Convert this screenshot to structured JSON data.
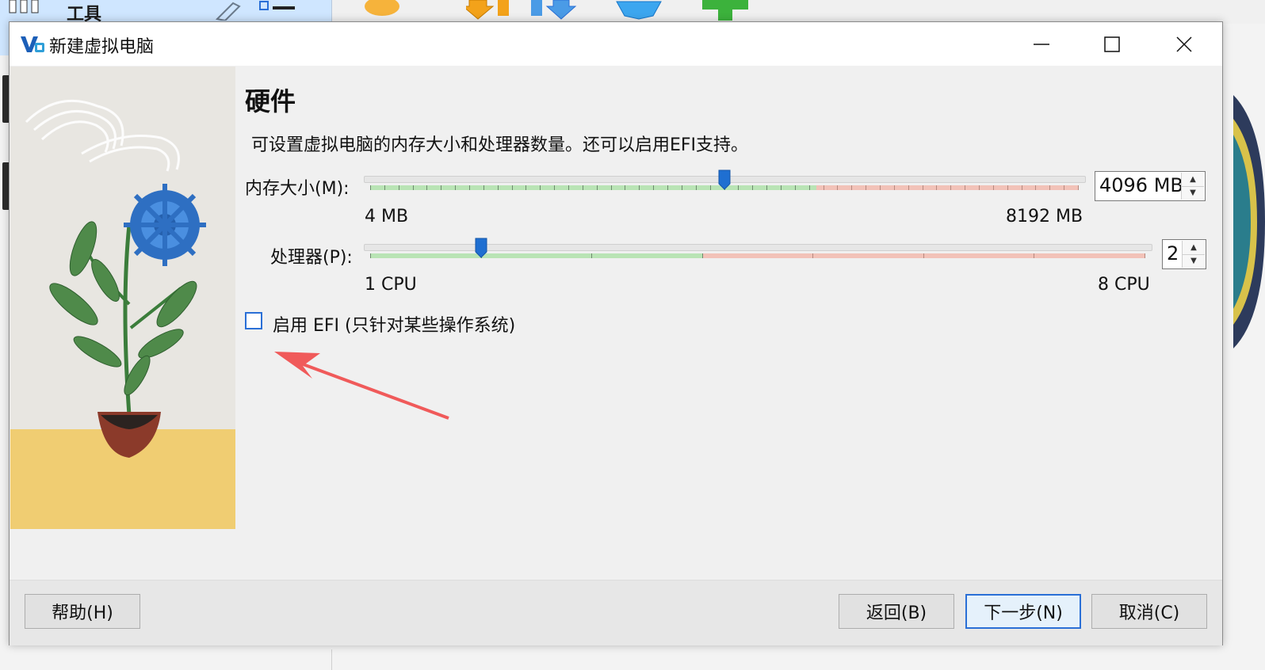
{
  "background": {
    "tools_label": "工具"
  },
  "dialog": {
    "title": "新建虚拟电脑",
    "heading": "硬件",
    "description": "可设置虚拟电脑的内存大小和处理器数量。还可以启用EFI支持。",
    "memory": {
      "label": "内存大小(M):",
      "value_text": "4096 MB",
      "min_label": "4 MB",
      "max_label": "8192 MB",
      "value_fraction": 0.5
    },
    "processor": {
      "label": "处理器(P):",
      "value_text": "2",
      "min_label": "1 CPU",
      "max_label": "8 CPU",
      "value_fraction": 0.143
    },
    "efi": {
      "label": "启用 EFI (只针对某些操作系统)",
      "checked": false
    },
    "buttons": {
      "help": "帮助(H)",
      "back": "返回(B)",
      "next": "下一步(N)",
      "cancel": "取消(C)"
    }
  },
  "colors": {
    "accent": "#2a6fd6",
    "slider_green": "#b9e4b5",
    "slider_red": "#f2c2b8",
    "annotation_arrow": "#f05a5a"
  },
  "icons": [
    "app-logo-icon",
    "minimize-icon",
    "maximize-icon",
    "close-icon",
    "slider-thumb-icon",
    "spin-up-icon",
    "spin-down-icon",
    "arrow-annotation-icon"
  ]
}
